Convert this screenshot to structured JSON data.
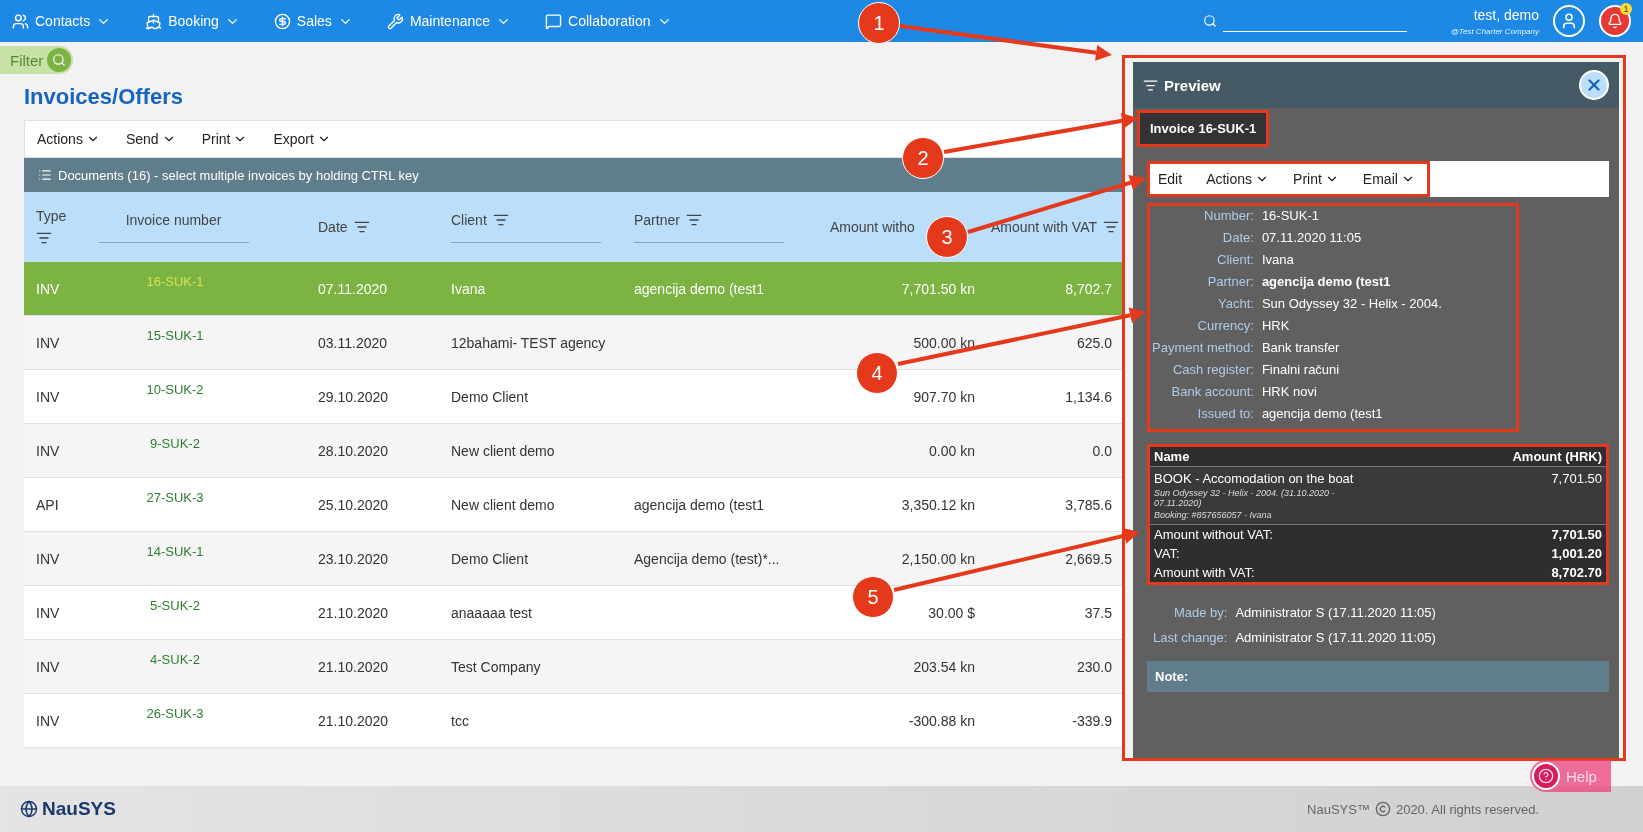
{
  "nav": {
    "items": [
      {
        "label": "Contacts"
      },
      {
        "label": "Booking"
      },
      {
        "label": "Sales"
      },
      {
        "label": "Maintenance"
      },
      {
        "label": "Collaboration"
      }
    ],
    "user": {
      "name": "test, demo",
      "company": "@Test Charter Company"
    },
    "notifications": "1"
  },
  "filter": {
    "label": "Filter"
  },
  "page_title": "Invoices/Offers",
  "toolbar": [
    "Actions",
    "Send",
    "Print",
    "Export"
  ],
  "documents_header": "Documents (16) - select multiple invoices by holding CTRL key",
  "table": {
    "columns": [
      "Type",
      "Invoice number",
      "Date",
      "Client",
      "Partner",
      "Amount witho",
      "Amount with VAT"
    ],
    "rows": [
      {
        "type": "INV",
        "number": "16-SUK-1",
        "date": "07.11.2020",
        "client": "Ivana",
        "partner": "agencija demo (test1",
        "amount": "7,701.50 kn",
        "amount_vat": "8,702.7",
        "selected": true
      },
      {
        "type": "INV",
        "number": "15-SUK-1",
        "date": "03.11.2020",
        "client": "12bahami- TEST agency",
        "amount": "500.00 kn",
        "amount_vat": "625.0",
        "selected": false
      },
      {
        "type": "INV",
        "number": "10-SUK-2",
        "date": "29.10.2020",
        "client": "Demo Client",
        "amount": "907.70 kn",
        "amount_vat": "1,134.6",
        "selected": false
      },
      {
        "type": "INV",
        "number": "9-SUK-2",
        "date": "28.10.2020",
        "client": "New client demo",
        "amount": "0.00 kn",
        "amount_vat": "0.0",
        "selected": false
      },
      {
        "type": "API",
        "number": "27-SUK-3",
        "date": "25.10.2020",
        "client": "New client demo",
        "partner": "agencija demo (test1",
        "amount": "3,350.12 kn",
        "amount_vat": "3,785.6",
        "selected": false
      },
      {
        "type": "INV",
        "number": "14-SUK-1",
        "date": "23.10.2020",
        "client": "Demo Client",
        "partner": "Agencija demo (test)*...",
        "amount": "2,150.00 kn",
        "amount_vat": "2,669.5",
        "selected": false
      },
      {
        "type": "INV",
        "number": "5-SUK-2",
        "date": "21.10.2020",
        "client": "anaaaaa test",
        "amount": "30.00 $",
        "amount_vat": "37.5",
        "selected": false
      },
      {
        "type": "INV",
        "number": "4-SUK-2",
        "date": "21.10.2020",
        "client": "Test Company",
        "amount": "203.54 kn",
        "amount_vat": "230.0",
        "selected": false
      },
      {
        "type": "INV",
        "number": "26-SUK-3",
        "date": "21.10.2020",
        "client": "tcc",
        "amount": "-300.88 kn",
        "amount_vat": "-339.9",
        "selected": false
      }
    ]
  },
  "preview": {
    "title": "Preview",
    "invoice_title": "Invoice 16-SUK-1",
    "toolbar": [
      {
        "label": "Edit",
        "dropdown": false
      },
      {
        "label": "Actions",
        "dropdown": true
      },
      {
        "label": "Print",
        "dropdown": true
      },
      {
        "label": "Email",
        "dropdown": true
      }
    ],
    "fields": [
      {
        "label": "Number:",
        "value": "16-SUK-1",
        "bold": false
      },
      {
        "label": "Date:",
        "value": "07.11.2020 11:05",
        "bold": false
      },
      {
        "label": "Client:",
        "value": "Ivana",
        "bold": false
      },
      {
        "label": "Partner:",
        "value": "agencija demo (test1",
        "bold": true
      },
      {
        "label": "Yacht:",
        "value": "Sun Odyssey 32 - Helix - 2004.",
        "bold": false
      },
      {
        "label": "Currency:",
        "value": "HRK",
        "bold": false
      },
      {
        "label": "Payment method:",
        "value": "Bank transfer",
        "bold": false
      },
      {
        "label": "Cash register:",
        "value": "Finalni računi",
        "bold": false
      },
      {
        "label": "Bank account:",
        "value": "HRK novi",
        "bold": false
      },
      {
        "label": "Issued to:",
        "value": "agencija demo (test1",
        "bold": false
      }
    ],
    "items": {
      "columns": [
        "Name",
        "Amount (HRK)"
      ],
      "lines": [
        {
          "name": "BOOK - Accomodation on the boat",
          "details": [
            "Sun Odyssey 32 - Helix - 2004. (31.10.2020 - 07.11.2020)",
            "Booking: #857656057 - Ivana"
          ],
          "amount": "7,701.50"
        }
      ],
      "totals": [
        {
          "label": "Amount without VAT:",
          "value": "7,701.50"
        },
        {
          "label": "VAT:",
          "value": "1,001.20"
        },
        {
          "label": "Amount with VAT:",
          "value": "8,702.70"
        }
      ]
    },
    "audit": [
      {
        "label": "Made by:",
        "value": "Administrator S (17.11.2020 11:05)"
      },
      {
        "label": "Last change:",
        "value": "Administrator S (17.11.2020 11:05)"
      }
    ],
    "note": "Note:"
  },
  "help": "Help",
  "callouts": [
    "1",
    "2",
    "3",
    "4",
    "5"
  ],
  "footer": {
    "logo": "NauSYS",
    "brand": "NauSYS™",
    "copyright": "2020. All rights reserved."
  }
}
